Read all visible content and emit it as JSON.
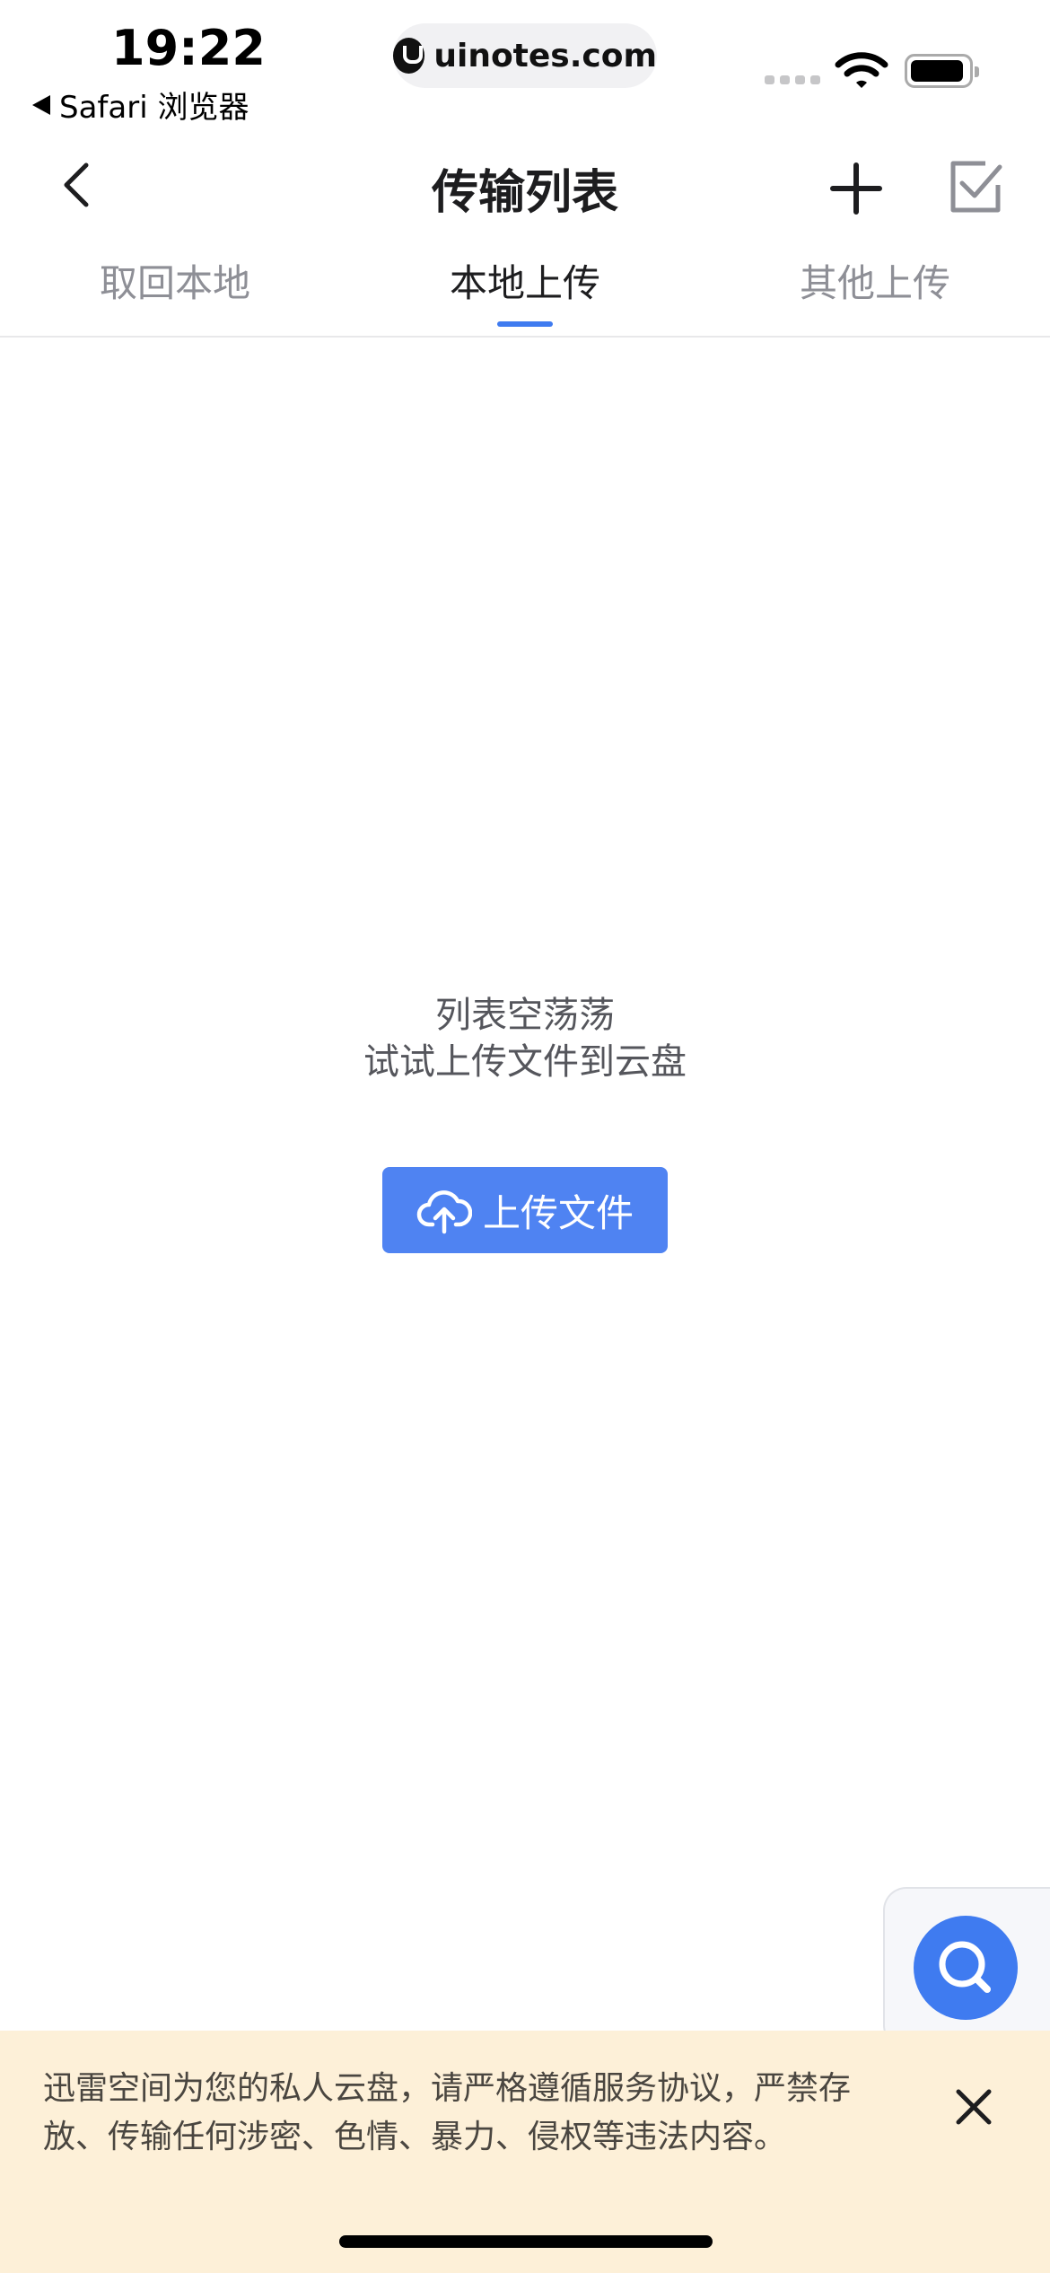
{
  "status_bar": {
    "time": "19:22",
    "back_app": "Safari 浏览器",
    "url": "uinotes.com"
  },
  "nav": {
    "title": "传输列表",
    "icons": {
      "back": "chevron-left-icon",
      "add": "plus-icon",
      "select": "checkbox-checked-icon"
    }
  },
  "tabs": [
    {
      "label": "取回本地",
      "active": false
    },
    {
      "label": "本地上传",
      "active": true
    },
    {
      "label": "其他上传",
      "active": false
    }
  ],
  "empty_state": {
    "line1": "列表空荡荡",
    "line2": "试试上传文件到云盘",
    "upload_button_label": "上传文件",
    "upload_icon": "cloud-upload-icon"
  },
  "floating": {
    "icon": "search-icon"
  },
  "notice": {
    "text": "迅雷空间为您的私人云盘，请严格遵循服务协议，严禁存放、传输任何涉密、色情、暴力、侵权等违法内容。",
    "close_icon": "close-icon"
  },
  "colors": {
    "accent": "#3f7bf0",
    "button": "#4f83f2",
    "notice_bg": "#fdf0d8",
    "inactive_tab": "#8e8f96"
  }
}
